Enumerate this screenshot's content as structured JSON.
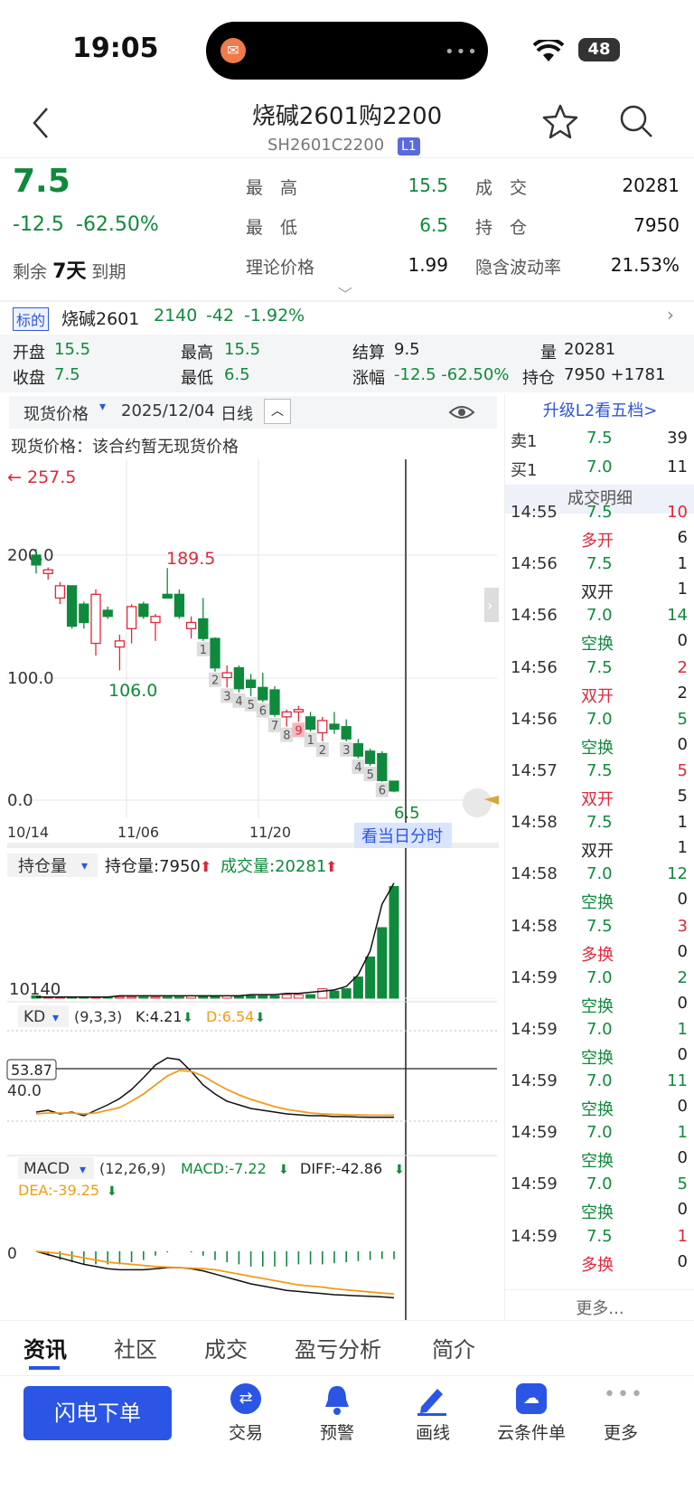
{
  "status": {
    "time": "19:05",
    "battery": "48"
  },
  "header": {
    "title": "烧碱2601购2200",
    "code": "SH2601C2200",
    "level": "L1"
  },
  "quote": {
    "price": "7.5",
    "change": "-12.5",
    "pct": "-62.50%",
    "remain_prefix": "剩余",
    "remain_days": "7天",
    "remain_suffix": "到期",
    "high_label": "最　高",
    "high": "15.5",
    "low_label": "最　低",
    "low": "6.5",
    "theory_label": "理论价格",
    "theory": "1.99",
    "vol_label": "成　交",
    "vol": "20281",
    "oi_label": "持　仓",
    "oi": "7950",
    "iv_label": "隐含波动率",
    "iv": "21.53%"
  },
  "underlying": {
    "tag": "标的",
    "name": "烧碱2601",
    "price": "2140",
    "change": "-42",
    "pct": "-1.92%"
  },
  "stats": {
    "open_label": "开盘",
    "open": "15.5",
    "high_label": "最高",
    "high": "15.5",
    "settle_label": "结算",
    "settle": "9.5",
    "vol_label": "量",
    "vol": "20281",
    "close_label": "收盘",
    "close": "7.5",
    "low_label": "最低",
    "low": "6.5",
    "chg_label": "涨幅",
    "chg": "-12.5 -62.50%",
    "oi_label": "持仓",
    "oi": "7950 +1781"
  },
  "chart_toolbar": {
    "spot_select": "现货价格",
    "date": "2025/12/04",
    "period": "日线",
    "spot_note": "现货价格：该合约暂无现货价格"
  },
  "kline": {
    "top_marker": "257.5",
    "high_label": "189.5",
    "low_label": "106.0",
    "last_label": "6.5",
    "y_ticks": [
      "200.0",
      "100.0",
      "0.0"
    ],
    "x_ticks": [
      "10/14",
      "11/06",
      "11/20"
    ],
    "intraday_btn": "看当日分时",
    "seq_labels": [
      "1",
      "2",
      "3",
      "4",
      "5",
      "6",
      "7",
      "8",
      "9",
      "1",
      "2",
      "3",
      "4",
      "5",
      "6"
    ]
  },
  "volume_pane": {
    "select": "持仓量",
    "oi_text": "持仓量:7950",
    "vol_text": "成交量:20281",
    "tick": "10140"
  },
  "kd_pane": {
    "select": "KD",
    "params": "(9,3,3)",
    "k_text": "K:4.21",
    "d_text": "D:6.54",
    "marker": "53.87",
    "tick": "40.0"
  },
  "macd_pane": {
    "select": "MACD",
    "params": "(12,26,9)",
    "macd_text": "MACD:-7.22",
    "diff_text": "DIFF:-42.86",
    "dea_text": "DEA:-39.25",
    "tick": "0"
  },
  "book": {
    "upgrade": "升级L2看五档>",
    "ask_label": "卖1",
    "ask_price": "7.5",
    "ask_qty": "39",
    "bid_label": "买1",
    "bid_price": "7.0",
    "bid_qty": "11",
    "detail_title": "成交明细",
    "more": "更多..."
  },
  "trades": [
    {
      "time": "14:55",
      "price": "7.5",
      "qty": "10",
      "type": "多开",
      "tqty": "6",
      "pc": "green",
      "qc": "red",
      "tc": "red"
    },
    {
      "time": "14:56",
      "price": "7.5",
      "qty": "1",
      "type": "双开",
      "tqty": "1",
      "pc": "green",
      "qc": "dark",
      "tc": "dark"
    },
    {
      "time": "14:56",
      "price": "7.0",
      "qty": "14",
      "type": "空换",
      "tqty": "0",
      "pc": "green",
      "qc": "green",
      "tc": "green"
    },
    {
      "time": "14:56",
      "price": "7.5",
      "qty": "2",
      "type": "双开",
      "tqty": "2",
      "pc": "green",
      "qc": "red",
      "tc": "red"
    },
    {
      "time": "14:56",
      "price": "7.0",
      "qty": "5",
      "type": "空换",
      "tqty": "0",
      "pc": "green",
      "qc": "green",
      "tc": "green"
    },
    {
      "time": "14:57",
      "price": "7.5",
      "qty": "5",
      "type": "双开",
      "tqty": "5",
      "pc": "green",
      "qc": "red",
      "tc": "red"
    },
    {
      "time": "14:58",
      "price": "7.5",
      "qty": "1",
      "type": "双开",
      "tqty": "1",
      "pc": "green",
      "qc": "dark",
      "tc": "dark"
    },
    {
      "time": "14:58",
      "price": "7.0",
      "qty": "12",
      "type": "空换",
      "tqty": "0",
      "pc": "green",
      "qc": "green",
      "tc": "green"
    },
    {
      "time": "14:58",
      "price": "7.5",
      "qty": "3",
      "type": "多换",
      "tqty": "0",
      "pc": "green",
      "qc": "red",
      "tc": "red"
    },
    {
      "time": "14:59",
      "price": "7.0",
      "qty": "2",
      "type": "空换",
      "tqty": "0",
      "pc": "green",
      "qc": "green",
      "tc": "green"
    },
    {
      "time": "14:59",
      "price": "7.0",
      "qty": "1",
      "type": "空换",
      "tqty": "0",
      "pc": "green",
      "qc": "green",
      "tc": "green"
    },
    {
      "time": "14:59",
      "price": "7.0",
      "qty": "11",
      "type": "空换",
      "tqty": "0",
      "pc": "green",
      "qc": "green",
      "tc": "green"
    },
    {
      "time": "14:59",
      "price": "7.0",
      "qty": "1",
      "type": "空换",
      "tqty": "0",
      "pc": "green",
      "qc": "green",
      "tc": "green"
    },
    {
      "time": "14:59",
      "price": "7.0",
      "qty": "5",
      "type": "空换",
      "tqty": "0",
      "pc": "green",
      "qc": "green",
      "tc": "green"
    },
    {
      "time": "14:59",
      "price": "7.5",
      "qty": "1",
      "type": "多换",
      "tqty": "0",
      "pc": "green",
      "qc": "red",
      "tc": "red"
    }
  ],
  "tabs": [
    "资讯",
    "社区",
    "成交",
    "盈亏分析",
    "简介"
  ],
  "bottom": {
    "order_btn": "闪电下单",
    "items": [
      "交易",
      "预警",
      "画线",
      "云条件单",
      "更多"
    ]
  },
  "colors": {
    "up": "#e0283a",
    "down": "#0f8a3c",
    "accent": "#2a55e5",
    "orange": "#f29b1a"
  },
  "chart_data": {
    "type": "candlestick",
    "y_ticks": [
      "200.0",
      "100.0",
      "0.0"
    ],
    "x_ticks": [
      "10/14",
      "11/06",
      "11/20"
    ],
    "ylim": [
      0,
      257.5
    ],
    "candles": [
      {
        "o": 200,
        "h": 205,
        "l": 185,
        "c": 192
      },
      {
        "o": 185,
        "h": 190,
        "l": 180,
        "c": 188
      },
      {
        "o": 165,
        "h": 178,
        "l": 160,
        "c": 175
      },
      {
        "o": 175,
        "h": 175,
        "l": 140,
        "c": 142
      },
      {
        "o": 160,
        "h": 162,
        "l": 140,
        "c": 145
      },
      {
        "o": 128,
        "h": 172,
        "l": 118,
        "c": 168
      },
      {
        "o": 155,
        "h": 158,
        "l": 148,
        "c": 150
      },
      {
        "o": 125,
        "h": 135,
        "l": 106,
        "c": 130
      },
      {
        "o": 140,
        "h": 160,
        "l": 128,
        "c": 158
      },
      {
        "o": 160,
        "h": 162,
        "l": 148,
        "c": 150
      },
      {
        "o": 145,
        "h": 152,
        "l": 130,
        "c": 150
      },
      {
        "o": 168,
        "h": 189.5,
        "l": 165,
        "c": 165
      },
      {
        "o": 168,
        "h": 172,
        "l": 148,
        "c": 150
      },
      {
        "o": 140,
        "h": 150,
        "l": 132,
        "c": 145
      },
      {
        "o": 148,
        "h": 165,
        "l": 130,
        "c": 132
      },
      {
        "o": 132,
        "h": 133,
        "l": 105,
        "c": 108
      },
      {
        "o": 100,
        "h": 110,
        "l": 92,
        "c": 104
      },
      {
        "o": 108,
        "h": 110,
        "l": 88,
        "c": 91
      },
      {
        "o": 98,
        "h": 103,
        "l": 85,
        "c": 92
      },
      {
        "o": 92,
        "h": 104,
        "l": 80,
        "c": 82
      },
      {
        "o": 90,
        "h": 93,
        "l": 68,
        "c": 70
      },
      {
        "o": 68,
        "h": 74,
        "l": 60,
        "c": 72
      },
      {
        "o": 72,
        "h": 77,
        "l": 64,
        "c": 74
      },
      {
        "o": 68,
        "h": 72,
        "l": 56,
        "c": 58
      },
      {
        "o": 55,
        "h": 68,
        "l": 48,
        "c": 65
      },
      {
        "o": 62,
        "h": 72,
        "l": 54,
        "c": 58
      },
      {
        "o": 60,
        "h": 66,
        "l": 48,
        "c": 50
      },
      {
        "o": 46,
        "h": 50,
        "l": 34,
        "c": 36
      },
      {
        "o": 40,
        "h": 42,
        "l": 28,
        "c": 30
      },
      {
        "o": 38,
        "h": 40,
        "l": 15,
        "c": 16
      },
      {
        "o": 15.5,
        "h": 15.5,
        "l": 6.5,
        "c": 7.5
      }
    ],
    "volume": [
      2,
      1,
      1,
      1,
      1,
      1,
      1,
      1,
      1,
      1,
      1,
      1,
      1,
      2,
      2,
      2,
      2,
      2,
      2,
      2,
      2,
      3,
      3,
      3,
      8,
      6,
      8,
      18,
      35,
      60,
      95
    ],
    "oi_line": [
      1,
      1,
      1,
      1,
      1,
      1,
      1,
      2,
      2,
      2,
      2,
      2,
      2,
      2,
      2,
      2,
      2,
      2,
      3,
      3,
      3,
      4,
      4,
      5,
      6,
      7,
      10,
      20,
      40,
      80,
      98
    ],
    "kd": {
      "k": [
        10,
        12,
        8,
        10,
        6,
        12,
        18,
        25,
        35,
        48,
        62,
        70,
        68,
        55,
        40,
        30,
        22,
        18,
        14,
        12,
        10,
        8,
        7,
        6,
        6,
        5,
        5,
        4.5,
        4.3,
        4.2,
        4.21
      ],
      "d": [
        8,
        9,
        9,
        9,
        8,
        9,
        12,
        15,
        22,
        30,
        40,
        50,
        56,
        55,
        50,
        42,
        35,
        29,
        24,
        20,
        16,
        13,
        11,
        9,
        8,
        7.5,
        7,
        6.8,
        6.6,
        6.5,
        6.54
      ]
    },
    "macd": {
      "diff": [
        0,
        -3,
        -6,
        -9,
        -12,
        -14,
        -16,
        -17,
        -17,
        -17,
        -16,
        -15,
        -15,
        -16,
        -18,
        -21,
        -24,
        -27,
        -30,
        -32,
        -34,
        -36,
        -37,
        -38,
        -39,
        -40,
        -40.5,
        -41,
        -41.5,
        -42,
        -42.86
      ],
      "dea": [
        0,
        -1,
        -2,
        -4,
        -6,
        -8,
        -10,
        -11,
        -12,
        -13,
        -14,
        -14.5,
        -15,
        -15.5,
        -16,
        -17,
        -19,
        -21,
        -23,
        -25,
        -27,
        -29,
        -31,
        -32,
        -33,
        -34.5,
        -35.5,
        -36.5,
        -37.5,
        -38.5,
        -39.25
      ],
      "hist": [
        0,
        -4,
        -8,
        -10,
        -12,
        -12,
        -12,
        -12,
        -10,
        -8,
        -4,
        -1,
        0,
        -1,
        -4,
        -8,
        -10,
        -12,
        -14,
        -14,
        -14,
        -14,
        -12,
        -12,
        -12,
        -11,
        -10,
        -9,
        -8,
        -7,
        -7.22
      ]
    }
  }
}
